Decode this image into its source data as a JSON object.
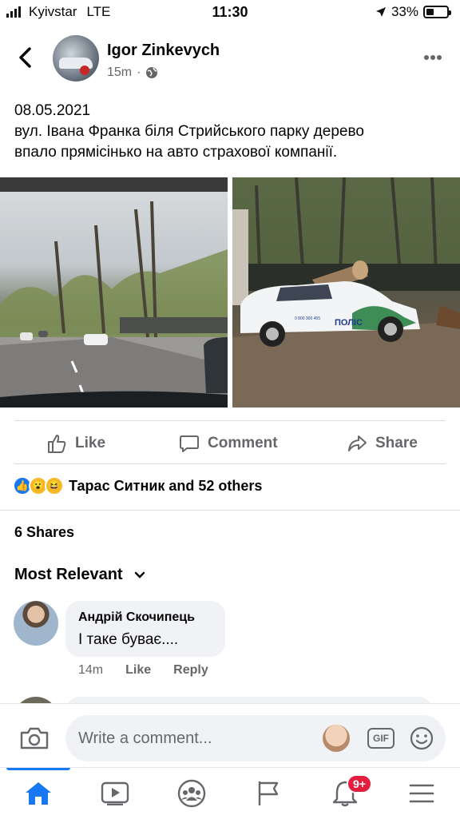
{
  "status_bar": {
    "carrier": "Kyivstar",
    "network": "LTE",
    "time": "11:30",
    "battery": "33%"
  },
  "post": {
    "author": "Igor Zinkevych",
    "time": "15m",
    "text_line1": "08.05.2021",
    "text_line2": "вул. Івана Франка біля Стрийського парку дерево",
    "text_line3": "впало прямісінько на авто страхової компанії.",
    "photo2_car_label": "ПОЛІС",
    "photo2_car_phone": "0 800 300 455"
  },
  "actions": {
    "like": "Like",
    "comment": "Comment",
    "share": "Share"
  },
  "reactions": {
    "text": "Тарас Ситник and 52 others",
    "icons": [
      "like-icon",
      "wow-icon",
      "haha-icon"
    ]
  },
  "shares": "6 Shares",
  "sort": "Most Relevant",
  "comment": {
    "author": "Андрій Скочипець",
    "text": "І таке буває....",
    "time": "14m",
    "like": "Like",
    "reply": "Reply"
  },
  "composer": {
    "placeholder": "Write a comment...",
    "gif": "GIF"
  },
  "tabs": {
    "notifications_badge": "9+"
  },
  "colors": {
    "accent": "#1877f2",
    "muted": "#65676b",
    "bubble": "#f0f2f5",
    "badge": "#e41e3f"
  }
}
